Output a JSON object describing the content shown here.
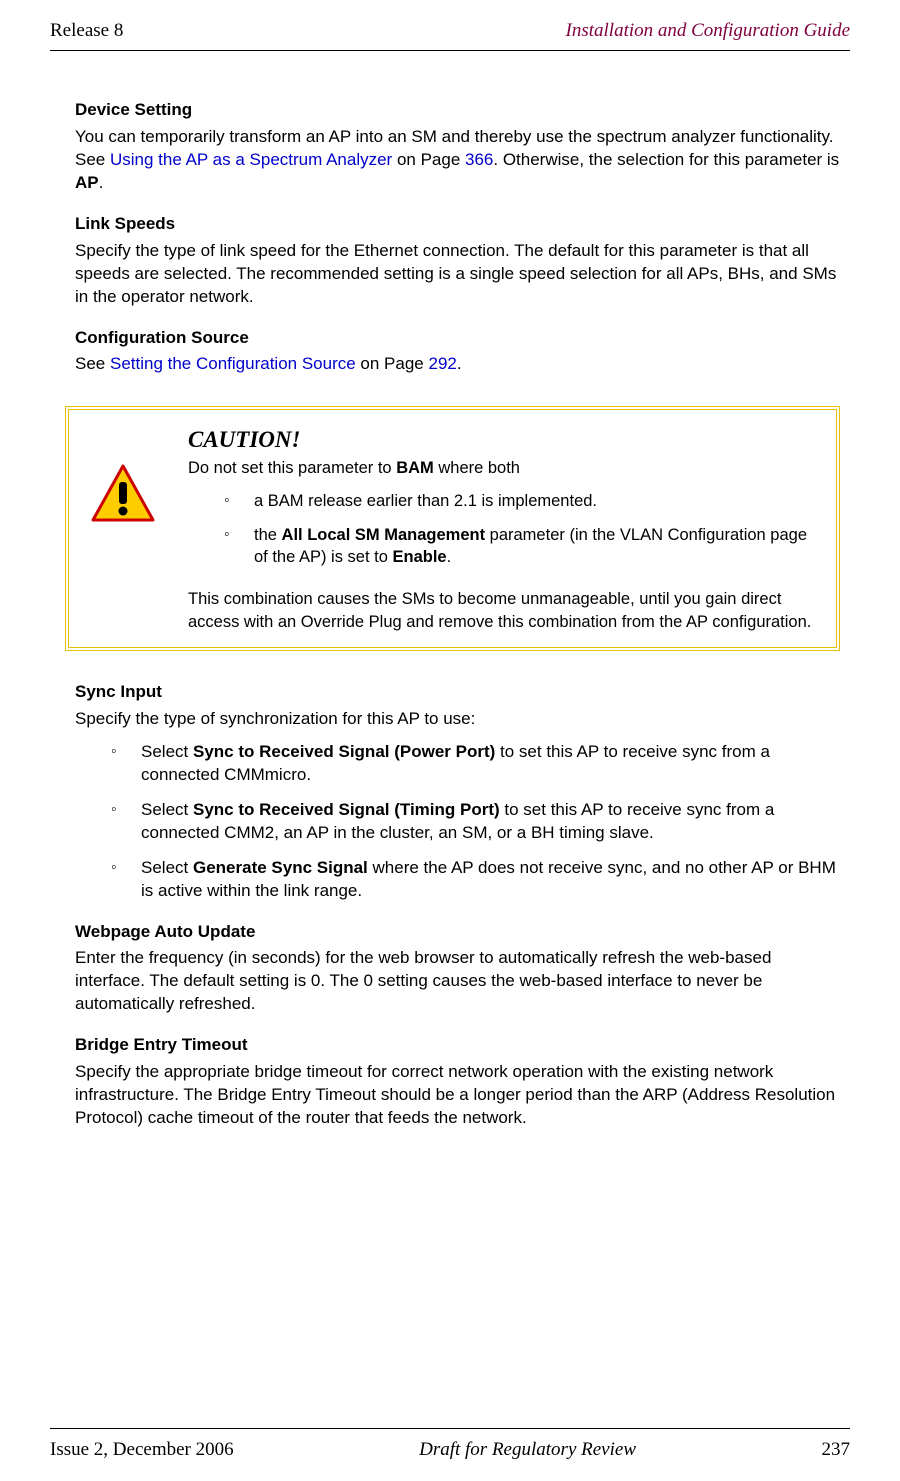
{
  "header": {
    "left": "Release 8",
    "right": "Installation and Configuration Guide"
  },
  "device_setting": {
    "heading": "Device Setting",
    "p1_a": "You can temporarily transform an AP into an SM and thereby use the spectrum analyzer functionality. See ",
    "link1": "Using the AP as a Spectrum Analyzer",
    "p1_b": " on Page ",
    "page_ref": "366",
    "p1_c": ". Otherwise, the selection for this parameter is ",
    "bold_end": "AP",
    "p1_d": "."
  },
  "link_speeds": {
    "heading": "Link Speeds",
    "p": "Specify the type of link speed for the Ethernet connection. The default for this parameter is that all speeds are selected. The recommended setting is a single speed selection for all APs, BHs, and SMs in the operator network."
  },
  "config_source": {
    "heading": "Configuration Source",
    "p_a": "See ",
    "link": "Setting the Configuration Source",
    "p_b": " on Page ",
    "page_ref": "292",
    "p_c": "."
  },
  "caution": {
    "title": "CAUTION!",
    "intro_a": "Do not set this parameter to ",
    "intro_bold": "BAM",
    "intro_b": " where both",
    "li1": "a BAM release earlier than 2.1 is implemented.",
    "li2_a": "the ",
    "li2_bold1": "All Local SM Management",
    "li2_b": " parameter (in the VLAN Configuration page of the AP) is set to ",
    "li2_bold2": "Enable",
    "li2_c": ".",
    "outro": "This combination causes the SMs to become unmanageable, until you gain direct access with an Override Plug and remove this combination from the AP configuration."
  },
  "sync_input": {
    "heading": "Sync Input",
    "intro": "Specify the type of synchronization for this AP to use:",
    "li1_a": "Select ",
    "li1_bold": "Sync to Received Signal (Power Port)",
    "li1_b": " to set this AP to receive sync from a connected CMMmicro.",
    "li2_a": "Select ",
    "li2_bold": "Sync to Received Signal (Timing Port)",
    "li2_b": " to set this AP to receive sync from a connected CMM2, an AP in the cluster, an SM, or a BH timing slave.",
    "li3_a": "Select ",
    "li3_bold": "Generate Sync Signal",
    "li3_b": " where the AP does not receive sync, and no other AP or BHM is active within the link range."
  },
  "webpage_auto": {
    "heading": "Webpage Auto Update",
    "p": "Enter the frequency (in seconds) for the web browser to automatically refresh the web-based interface. The default setting is 0. The 0 setting causes the web-based interface to never be automatically refreshed."
  },
  "bridge_entry": {
    "heading": "Bridge Entry Timeout",
    "p": "Specify the appropriate bridge timeout for correct network operation with the existing network infrastructure. The Bridge Entry Timeout should be a longer period than the ARP (Address Resolution Protocol) cache timeout of the router that feeds the network."
  },
  "footer": {
    "left": "Issue 2, December 2006",
    "center": "Draft for Regulatory Review",
    "right": "237"
  }
}
